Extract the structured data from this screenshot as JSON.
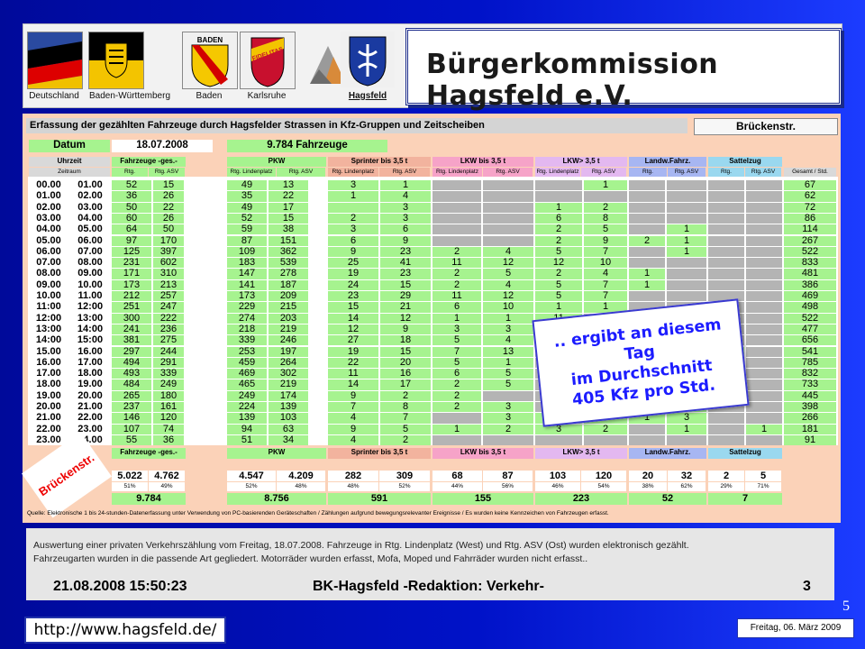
{
  "header": {
    "flags": [
      {
        "label": "Deutschland"
      },
      {
        "label": "Baden-Württemberg"
      },
      {
        "label": "Baden",
        "text": "BADEN"
      },
      {
        "label": "Karlsruhe",
        "text": "FIDELITAS"
      },
      {
        "label": ""
      },
      {
        "label": "Hagsfeld"
      }
    ],
    "brand": "Bürgerkommission Hagsfeld e.V."
  },
  "sheet": {
    "title": "Erfassung der gezählten Fahrzeuge durch Hagsfelder Strassen in Kfz-Gruppen und Zeitscheiben",
    "street": "Brückenstr.",
    "datum_label": "Datum",
    "datum_value": "18.07.2008",
    "total_label": "9.784      Fahrzeuge",
    "uhrzeit_label": "Uhrzeit",
    "zeitraum_label": "Zeitraum",
    "groups": [
      "Fahrzeuge -ges.-",
      "PKW",
      "Sprinter bis 3,5 t",
      "LKW bis 3,5 t",
      "LKW> 3,5 t",
      "Landw.Fahrz.",
      "Sattelzug"
    ],
    "sub_a": "Rtg. Lindenplatz",
    "sub_b": "Rtg. ASV",
    "gesamt_label": "Gesamt / Std.",
    "rows": [
      {
        "from": "00.00",
        "to": "01.00",
        "ga": "52",
        "gb": "15",
        "pa": "49",
        "pb": "13",
        "sa": "3",
        "sb": "1",
        "la": "",
        "lb": "",
        "ha": "",
        "hb": "1",
        "wa": "",
        "wb": "",
        "za": "",
        "zb": "",
        "t": "67"
      },
      {
        "from": "01.00",
        "to": "02.00",
        "ga": "36",
        "gb": "26",
        "pa": "35",
        "pb": "22",
        "sa": "1",
        "sb": "4",
        "la": "",
        "lb": "",
        "ha": "",
        "hb": "",
        "wa": "",
        "wb": "",
        "za": "",
        "zb": "",
        "t": "62"
      },
      {
        "from": "02.00",
        "to": "03.00",
        "ga": "50",
        "gb": "22",
        "pa": "49",
        "pb": "17",
        "sa": "",
        "sb": "3",
        "la": "",
        "lb": "",
        "ha": "1",
        "hb": "2",
        "wa": "",
        "wb": "",
        "za": "",
        "zb": "",
        "t": "72"
      },
      {
        "from": "03.00",
        "to": "04.00",
        "ga": "60",
        "gb": "26",
        "pa": "52",
        "pb": "15",
        "sa": "2",
        "sb": "3",
        "la": "",
        "lb": "",
        "ha": "6",
        "hb": "8",
        "wa": "",
        "wb": "",
        "za": "",
        "zb": "",
        "t": "86"
      },
      {
        "from": "04.00",
        "to": "05.00",
        "ga": "64",
        "gb": "50",
        "pa": "59",
        "pb": "38",
        "sa": "3",
        "sb": "6",
        "la": "",
        "lb": "",
        "ha": "2",
        "hb": "5",
        "wa": "",
        "wb": "1",
        "za": "",
        "zb": "",
        "t": "114"
      },
      {
        "from": "05.00",
        "to": "06.00",
        "ga": "97",
        "gb": "170",
        "pa": "87",
        "pb": "151",
        "sa": "6",
        "sb": "9",
        "la": "",
        "lb": "",
        "ha": "2",
        "hb": "9",
        "wa": "2",
        "wb": "1",
        "za": "",
        "zb": "",
        "t": "267"
      },
      {
        "from": "06.00",
        "to": "07.00",
        "ga": "125",
        "gb": "397",
        "pa": "109",
        "pb": "362",
        "sa": "9",
        "sb": "23",
        "la": "2",
        "lb": "4",
        "ha": "5",
        "hb": "7",
        "wa": "",
        "wb": "1",
        "za": "",
        "zb": "",
        "t": "522"
      },
      {
        "from": "07.00",
        "to": "08.00",
        "ga": "231",
        "gb": "602",
        "pa": "183",
        "pb": "539",
        "sa": "25",
        "sb": "41",
        "la": "11",
        "lb": "12",
        "ha": "12",
        "hb": "10",
        "wa": "",
        "wb": "",
        "za": "",
        "zb": "",
        "t": "833"
      },
      {
        "from": "08.00",
        "to": "09.00",
        "ga": "171",
        "gb": "310",
        "pa": "147",
        "pb": "278",
        "sa": "19",
        "sb": "23",
        "la": "2",
        "lb": "5",
        "ha": "2",
        "hb": "4",
        "wa": "1",
        "wb": "",
        "za": "",
        "zb": "",
        "t": "481"
      },
      {
        "from": "09.00",
        "to": "10.00",
        "ga": "173",
        "gb": "213",
        "pa": "141",
        "pb": "187",
        "sa": "24",
        "sb": "15",
        "la": "2",
        "lb": "4",
        "ha": "5",
        "hb": "7",
        "wa": "1",
        "wb": "",
        "za": "",
        "zb": "",
        "t": "386"
      },
      {
        "from": "10.00",
        "to": "11.00",
        "ga": "212",
        "gb": "257",
        "pa": "173",
        "pb": "209",
        "sa": "23",
        "sb": "29",
        "la": "11",
        "lb": "12",
        "ha": "5",
        "hb": "7",
        "wa": "",
        "wb": "",
        "za": "",
        "zb": "",
        "t": "469"
      },
      {
        "from": "11:00",
        "to": "12:00",
        "ga": "251",
        "gb": "247",
        "pa": "229",
        "pb": "215",
        "sa": "15",
        "sb": "21",
        "la": "6",
        "lb": "10",
        "ha": "1",
        "hb": "1",
        "wa": "",
        "wb": "",
        "za": "",
        "zb": "",
        "t": "498"
      },
      {
        "from": "12:00",
        "to": "13:00",
        "ga": "300",
        "gb": "222",
        "pa": "274",
        "pb": "203",
        "sa": "14",
        "sb": "12",
        "la": "1",
        "lb": "1",
        "ha": "11",
        "hb": "",
        "wa": "",
        "wb": "",
        "za": "",
        "zb": "",
        "t": "522"
      },
      {
        "from": "13:00",
        "to": "14:00",
        "ga": "241",
        "gb": "236",
        "pa": "218",
        "pb": "219",
        "sa": "12",
        "sb": "9",
        "la": "3",
        "lb": "3",
        "ha": "",
        "hb": "",
        "wa": "",
        "wb": "",
        "za": "",
        "zb": "",
        "t": "477"
      },
      {
        "from": "14:00",
        "to": "15:00",
        "ga": "381",
        "gb": "275",
        "pa": "339",
        "pb": "246",
        "sa": "27",
        "sb": "18",
        "la": "5",
        "lb": "4",
        "ha": "",
        "hb": "",
        "wa": "",
        "wb": "",
        "za": "",
        "zb": "",
        "t": "656"
      },
      {
        "from": "15.00",
        "to": "16.00",
        "ga": "297",
        "gb": "244",
        "pa": "253",
        "pb": "197",
        "sa": "19",
        "sb": "15",
        "la": "7",
        "lb": "13",
        "ha": "",
        "hb": "",
        "wa": "",
        "wb": "",
        "za": "2",
        "zb": "",
        "t": "541"
      },
      {
        "from": "16.00",
        "to": "17.00",
        "ga": "494",
        "gb": "291",
        "pa": "459",
        "pb": "264",
        "sa": "22",
        "sb": "20",
        "la": "5",
        "lb": "1",
        "ha": "",
        "hb": "",
        "wa": "",
        "wb": "",
        "za": "",
        "zb": "",
        "t": "785"
      },
      {
        "from": "17.00",
        "to": "18.00",
        "ga": "493",
        "gb": "339",
        "pa": "469",
        "pb": "302",
        "sa": "11",
        "sb": "16",
        "la": "6",
        "lb": "5",
        "ha": "",
        "hb": "",
        "wa": "",
        "wb": "",
        "za": "2",
        "zb": "",
        "t": "832"
      },
      {
        "from": "18.00",
        "to": "19.00",
        "ga": "484",
        "gb": "249",
        "pa": "465",
        "pb": "219",
        "sa": "14",
        "sb": "17",
        "la": "2",
        "lb": "5",
        "ha": "",
        "hb": "",
        "wa": "",
        "wb": "",
        "za": "",
        "zb": "",
        "t": "733"
      },
      {
        "from": "19.00",
        "to": "20.00",
        "ga": "265",
        "gb": "180",
        "pa": "249",
        "pb": "174",
        "sa": "9",
        "sb": "2",
        "la": "2",
        "lb": "",
        "ha": "",
        "hb": "",
        "wa": "",
        "wb": "",
        "za": "",
        "zb": "",
        "t": "445"
      },
      {
        "from": "20.00",
        "to": "21.00",
        "ga": "237",
        "gb": "161",
        "pa": "224",
        "pb": "139",
        "sa": "7",
        "sb": "8",
        "la": "2",
        "lb": "3",
        "ha": "",
        "hb": "",
        "wa": "2",
        "wb": "6",
        "za": "",
        "zb": "",
        "t": "398"
      },
      {
        "from": "21.00",
        "to": "22.00",
        "ga": "146",
        "gb": "120",
        "pa": "139",
        "pb": "103",
        "sa": "4",
        "sb": "7",
        "la": "",
        "lb": "3",
        "ha": "2",
        "hb": "4",
        "wa": "1",
        "wb": "3",
        "za": "",
        "zb": "",
        "t": "266"
      },
      {
        "from": "22.00",
        "to": "23.00",
        "ga": "107",
        "gb": "74",
        "pa": "94",
        "pb": "63",
        "sa": "9",
        "sb": "5",
        "la": "1",
        "lb": "2",
        "ha": "3",
        "hb": "2",
        "wa": "",
        "wb": "1",
        "za": "",
        "zb": "1",
        "t": "181"
      },
      {
        "from": "23.00",
        "to": "24.00",
        "ga": "55",
        "gb": "36",
        "pa": "51",
        "pb": "34",
        "sa": "4",
        "sb": "2",
        "la": "",
        "lb": "",
        "ha": "",
        "hb": "",
        "wa": "",
        "wb": "",
        "za": "",
        "zb": "",
        "t": "91"
      }
    ],
    "summary": {
      "side_label": "Brückenstr.",
      "groups": [
        {
          "name": "Fahrzeuge -ges.-",
          "a": "5.022",
          "b": "4.762",
          "pa": "51%",
          "pb": "49%",
          "total": "9.784"
        },
        {
          "name": "PKW",
          "a": "4.547",
          "b": "4.209",
          "pa": "52%",
          "pb": "48%",
          "total": "8.756"
        },
        {
          "name": "Sprinter bis 3,5 t",
          "a": "282",
          "b": "309",
          "pa": "48%",
          "pb": "52%",
          "total": "591"
        },
        {
          "name": "LKW bis 3,5 t",
          "a": "68",
          "b": "87",
          "pa": "44%",
          "pb": "56%",
          "total": "155"
        },
        {
          "name": "LKW> 3,5 t",
          "a": "103",
          "b": "120",
          "pa": "46%",
          "pb": "54%",
          "total": "223"
        },
        {
          "name": "Landw.Fahrz.",
          "a": "20",
          "b": "32",
          "pa": "38%",
          "pb": "62%",
          "total": "52"
        },
        {
          "name": "Sattelzug",
          "a": "2",
          "b": "5",
          "pa": "29%",
          "pb": "71%",
          "total": "7"
        }
      ]
    },
    "source_note": "Quelle: Elektronische 1 bis 24-stunden-Datenerfassung unter Verwendung von PC-basierenden Geräteschaften / Zählungen aufgrund bewegungsrelevanter Ereignisse / Es wurden keine Kennzeichen von Fahrzeugen erfasst."
  },
  "callout": {
    "line1": ".. ergibt an diesem Tag",
    "line2": "im Durchschnitt",
    "line3": "405 Kfz pro Std."
  },
  "bottom": {
    "text1": "Auswertung  einer privaten Verkehrszählung vom Freitag, 18.07.2008. Fahrzeuge in Rtg. Lindenplatz (West) und Rtg. ASV (Ost) wurden elektronisch gezählt.",
    "text2": "Fahrzeugarten wurden in die passende Art gegliedert. Motorräder wurden erfasst, Mofa, Moped und Fahrräder wurden nicht erfasst..",
    "timestamp": "21.08.2008 15:50:23",
    "title": "BK-Hagsfeld -Redaktion: Verkehr-",
    "page": "3"
  },
  "footer": {
    "url": "http://www.hagsfeld.de/",
    "date": "Freitag, 06. März 2009",
    "slide_number": "5"
  }
}
